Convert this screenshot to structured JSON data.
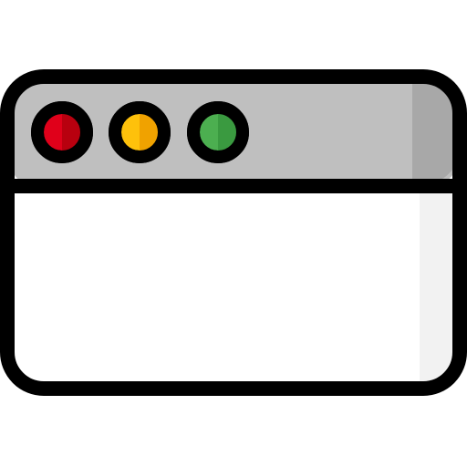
{
  "icon": {
    "name": "browser-window-icon",
    "colors": {
      "outline": "#000000",
      "titlebar": "#bfbfbf",
      "titlebar_shade": "#a8a8a8",
      "body": "#ffffff",
      "body_shade": "#f2f2f2",
      "close_button": "#e0001a",
      "close_button_shade": "#b8000f",
      "minimize_button": "#fec10b",
      "minimize_button_shade": "#f0a200",
      "maximize_button": "#4caf50",
      "maximize_button_shade": "#3a9a40"
    },
    "buttons": [
      {
        "name": "close-button-icon",
        "color_key": "close_button"
      },
      {
        "name": "minimize-button-icon",
        "color_key": "minimize_button"
      },
      {
        "name": "maximize-button-icon",
        "color_key": "maximize_button"
      }
    ]
  }
}
